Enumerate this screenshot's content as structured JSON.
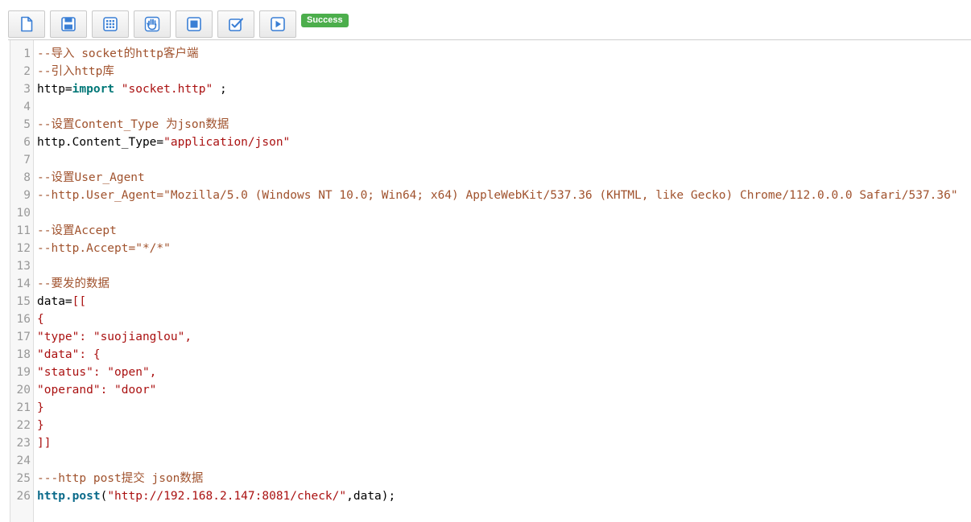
{
  "toolbar": {
    "buttons": [
      {
        "name": "new-file-button",
        "icon": "new-file-icon"
      },
      {
        "name": "save-button",
        "icon": "save-icon"
      },
      {
        "name": "grid-button",
        "icon": "grid-icon"
      },
      {
        "name": "hand-button",
        "icon": "hand-icon"
      },
      {
        "name": "stop-button",
        "icon": "stop-icon"
      },
      {
        "name": "check-button",
        "icon": "checkbox-icon"
      },
      {
        "name": "run-button",
        "icon": "play-icon"
      }
    ],
    "status_label": "Success",
    "icon_color": "#3a7fd5",
    "status_color": "#4cae4c"
  },
  "editor": {
    "lines": [
      {
        "num": "1",
        "tokens": [
          {
            "t": "comment",
            "v": "--导入 socket的http客户端"
          }
        ]
      },
      {
        "num": "2",
        "tokens": [
          {
            "t": "comment",
            "v": "--引入http库"
          }
        ]
      },
      {
        "num": "3",
        "tokens": [
          {
            "t": "plain",
            "v": "http="
          },
          {
            "t": "keyword",
            "v": "import"
          },
          {
            "t": "plain",
            "v": " "
          },
          {
            "t": "string",
            "v": "\"socket.http\""
          },
          {
            "t": "plain",
            "v": " ;"
          }
        ]
      },
      {
        "num": "4",
        "tokens": []
      },
      {
        "num": "5",
        "tokens": [
          {
            "t": "comment",
            "v": "--设置Content_Type 为json数据"
          }
        ]
      },
      {
        "num": "6",
        "tokens": [
          {
            "t": "plain",
            "v": "http.Content_Type="
          },
          {
            "t": "string",
            "v": "\"application/json\""
          }
        ]
      },
      {
        "num": "7",
        "tokens": []
      },
      {
        "num": "8",
        "tokens": [
          {
            "t": "comment",
            "v": "--设置User_Agent"
          }
        ]
      },
      {
        "num": "9",
        "tokens": [
          {
            "t": "comment",
            "v": "--http.User_Agent=\"Mozilla/5.0 (Windows NT 10.0; Win64; x64) AppleWebKit/537.36 (KHTML, like Gecko) Chrome/112.0.0.0 Safari/537.36\""
          }
        ]
      },
      {
        "num": "10",
        "tokens": []
      },
      {
        "num": "11",
        "tokens": [
          {
            "t": "comment",
            "v": "--设置Accept"
          }
        ]
      },
      {
        "num": "12",
        "tokens": [
          {
            "t": "comment",
            "v": "--http.Accept=\"*/*\""
          }
        ]
      },
      {
        "num": "13",
        "tokens": []
      },
      {
        "num": "14",
        "tokens": [
          {
            "t": "comment",
            "v": "--要发的数据"
          }
        ]
      },
      {
        "num": "15",
        "tokens": [
          {
            "t": "plain",
            "v": "data="
          },
          {
            "t": "string",
            "v": "[["
          }
        ]
      },
      {
        "num": "16",
        "tokens": [
          {
            "t": "string",
            "v": "{"
          }
        ]
      },
      {
        "num": "17",
        "tokens": [
          {
            "t": "string",
            "v": "\"type\": \"suojianglou\","
          }
        ]
      },
      {
        "num": "18",
        "tokens": [
          {
            "t": "string",
            "v": "\"data\": {"
          }
        ]
      },
      {
        "num": "19",
        "tokens": [
          {
            "t": "string",
            "v": "\"status\": \"open\","
          }
        ]
      },
      {
        "num": "20",
        "tokens": [
          {
            "t": "string",
            "v": "\"operand\": \"door\""
          }
        ]
      },
      {
        "num": "21",
        "tokens": [
          {
            "t": "string",
            "v": "}"
          }
        ]
      },
      {
        "num": "22",
        "tokens": [
          {
            "t": "string",
            "v": "}"
          }
        ]
      },
      {
        "num": "23",
        "tokens": [
          {
            "t": "string",
            "v": "]]"
          }
        ]
      },
      {
        "num": "24",
        "tokens": []
      },
      {
        "num": "25",
        "tokens": [
          {
            "t": "comment",
            "v": "---http post提交 json数据"
          }
        ]
      },
      {
        "num": "26",
        "tokens": [
          {
            "t": "func",
            "v": "http.post"
          },
          {
            "t": "plain",
            "v": "("
          },
          {
            "t": "string",
            "v": "\"http://192.168.2.147:8081/check/\""
          },
          {
            "t": "plain",
            "v": ",data);"
          }
        ]
      }
    ]
  }
}
